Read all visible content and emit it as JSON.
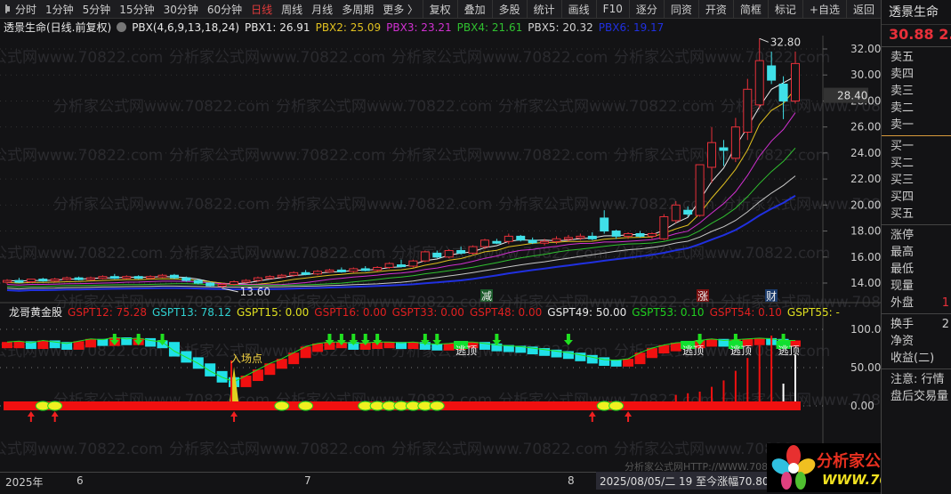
{
  "toolbar": {
    "periods": [
      "分时",
      "1分钟",
      "5分钟",
      "15分钟",
      "30分钟",
      "60分钟",
      "日线",
      "周线",
      "月线",
      "多周期",
      "更多 〉"
    ],
    "active_period": "日线",
    "buttons": [
      "复权",
      "叠加",
      "多股",
      "统计",
      "画线",
      "F10",
      "逐分",
      "同资",
      "开资",
      "简框",
      "标记",
      "+自选",
      "返回"
    ]
  },
  "main_header": {
    "title": "透景生命(日线.前复权)",
    "indicator": "PBX(4,6,9,13,18,24)",
    "values": [
      {
        "label": "PBX1: 26.91",
        "color": "#e8e8e8"
      },
      {
        "label": "PBX2: 25.09",
        "color": "#e0c020"
      },
      {
        "label": "PBX3: 23.21",
        "color": "#d030d0"
      },
      {
        "label": "PBX4: 21.61",
        "color": "#30c030"
      },
      {
        "label": "PBX5: 20.32",
        "color": "#d0d0d0"
      },
      {
        "label": "PBX6: 19.17",
        "color": "#2030e0"
      }
    ]
  },
  "price_axis": {
    "ticks": [
      "32.00",
      "30.00",
      "28.00",
      "26.00",
      "24.00",
      "22.00",
      "20.00",
      "18.00",
      "16.00",
      "14.00"
    ],
    "current": "28.40"
  },
  "annotations": {
    "high": "32.80",
    "low": "13.60",
    "markers": [
      {
        "text": "减",
        "bg": "#1a5a2a"
      },
      {
        "text": "涨",
        "bg": "#7a1010"
      },
      {
        "text": "财",
        "bg": "#1a3a6a"
      }
    ]
  },
  "indicator_header": {
    "title": "龙哥黄金股",
    "values": [
      {
        "label": "GSPT12: 75.28",
        "color": "#e02020"
      },
      {
        "label": "GSPT13: 78.12",
        "color": "#30d0d0"
      },
      {
        "label": "GSPT15: 0.00",
        "color": "#e0e020"
      },
      {
        "label": "GSPT16: 0.00",
        "color": "#e02020"
      },
      {
        "label": "GSPT33: 0.00",
        "color": "#e02020"
      },
      {
        "label": "GSPT48: 0.00",
        "color": "#e02020"
      },
      {
        "label": "GSPT49: 50.00",
        "color": "#e8e8e8"
      },
      {
        "label": "GSPT53: 0.10",
        "color": "#20d020"
      },
      {
        "label": "GSPT54: 0.10",
        "color": "#e02020"
      },
      {
        "label": "GSPT55: -",
        "color": "#e0e020"
      }
    ]
  },
  "indicator_axis": {
    "ticks": [
      "100.00",
      "50.00",
      "0.00"
    ]
  },
  "indicator_labels": {
    "entry": "入场点",
    "escape": "逃顶"
  },
  "date_axis": {
    "labels": [
      "2025年",
      "6",
      "7",
      "8"
    ],
    "cursor": "2025/08/05/二 19 至今涨幅70.80%"
  },
  "watermark": "分析家公式网www.70822.com",
  "watermark_bottom": "分析家公式网HTTP://WWW.70822.COM",
  "logo": {
    "cn": "分析家公式网",
    "url": "WWW.70822.COM"
  },
  "quote_panel": {
    "name": "透景生命",
    "price": "30.88",
    "change": "2.",
    "sell": [
      "卖五",
      "卖四",
      "卖三",
      "卖二",
      "卖一"
    ],
    "buy": [
      "买一",
      "买二",
      "买三",
      "买四",
      "买五"
    ],
    "stats": [
      {
        "label": "涨停",
        "value": ""
      },
      {
        "label": "最高",
        "value": ""
      },
      {
        "label": "最低",
        "value": ""
      },
      {
        "label": "现量",
        "value": ""
      },
      {
        "label": "外盘",
        "value": "1"
      }
    ],
    "stats2": [
      {
        "label": "换手",
        "value": "2"
      },
      {
        "label": "净资",
        "value": ""
      },
      {
        "label": "收益(二)",
        "value": ""
      }
    ],
    "notes": [
      "注意: 行情",
      "盘后交易量"
    ]
  },
  "colors": {
    "up": "#e8303a",
    "down": "#40e0e8",
    "bg": "#131315"
  },
  "chart_data": {
    "type": "candlestick",
    "ohlc": [
      [
        14.1,
        14.3,
        13.9,
        14.2
      ],
      [
        14.2,
        14.4,
        14.0,
        14.1
      ],
      [
        14.1,
        14.3,
        14.0,
        14.3
      ],
      [
        14.3,
        14.4,
        14.1,
        14.2
      ],
      [
        14.2,
        14.4,
        14.1,
        14.3
      ],
      [
        14.3,
        14.5,
        14.2,
        14.4
      ],
      [
        14.4,
        14.5,
        14.2,
        14.3
      ],
      [
        14.3,
        14.5,
        14.2,
        14.4
      ],
      [
        14.4,
        14.6,
        14.3,
        14.5
      ],
      [
        14.5,
        14.7,
        14.3,
        14.4
      ],
      [
        14.4,
        14.6,
        14.3,
        14.5
      ],
      [
        14.5,
        14.6,
        14.3,
        14.4
      ],
      [
        14.4,
        14.6,
        14.3,
        14.5
      ],
      [
        14.5,
        14.7,
        14.4,
        14.6
      ],
      [
        14.6,
        14.7,
        14.3,
        14.4
      ],
      [
        14.4,
        14.5,
        14.1,
        14.2
      ],
      [
        14.2,
        14.3,
        13.9,
        14.0
      ],
      [
        14.0,
        14.1,
        13.7,
        13.8
      ],
      [
        13.9,
        14.0,
        13.6,
        13.9
      ],
      [
        13.9,
        14.2,
        13.8,
        14.1
      ],
      [
        14.1,
        14.3,
        14.0,
        14.2
      ],
      [
        14.2,
        14.5,
        14.1,
        14.4
      ],
      [
        14.4,
        14.6,
        14.3,
        14.5
      ],
      [
        14.5,
        14.7,
        14.4,
        14.6
      ],
      [
        14.6,
        14.9,
        14.5,
        14.8
      ],
      [
        14.8,
        15.0,
        14.6,
        14.7
      ],
      [
        14.7,
        15.0,
        14.6,
        14.9
      ],
      [
        14.9,
        15.1,
        14.8,
        15.0
      ],
      [
        15.0,
        15.2,
        14.8,
        14.9
      ],
      [
        14.9,
        15.2,
        14.8,
        15.1
      ],
      [
        15.1,
        15.3,
        14.9,
        15.0
      ],
      [
        15.0,
        15.3,
        14.9,
        15.2
      ],
      [
        15.2,
        15.6,
        15.1,
        15.5
      ],
      [
        15.4,
        15.8,
        15.2,
        15.3
      ],
      [
        15.3,
        15.8,
        15.2,
        15.7
      ],
      [
        15.7,
        16.5,
        15.6,
        16.4
      ],
      [
        16.3,
        16.5,
        15.9,
        16.0
      ],
      [
        16.0,
        16.6,
        15.9,
        16.5
      ],
      [
        16.5,
        16.8,
        16.2,
        16.3
      ],
      [
        16.3,
        16.9,
        16.2,
        16.8
      ],
      [
        16.8,
        17.4,
        16.6,
        17.3
      ],
      [
        17.2,
        17.4,
        17.0,
        17.1
      ],
      [
        17.2,
        17.8,
        17.0,
        17.6
      ],
      [
        17.6,
        17.7,
        17.2,
        17.3
      ],
      [
        17.3,
        17.5,
        17.0,
        17.1
      ],
      [
        17.1,
        17.4,
        16.9,
        17.2
      ],
      [
        17.2,
        17.6,
        17.0,
        17.4
      ],
      [
        17.4,
        17.7,
        17.2,
        17.5
      ],
      [
        17.5,
        17.8,
        17.3,
        17.6
      ],
      [
        17.6,
        17.9,
        17.3,
        17.4
      ],
      [
        19.0,
        19.6,
        17.8,
        18.0
      ],
      [
        18.0,
        18.1,
        17.4,
        17.6
      ],
      [
        17.6,
        17.9,
        17.4,
        17.8
      ],
      [
        17.8,
        18.0,
        17.5,
        17.6
      ],
      [
        17.6,
        17.9,
        17.4,
        17.8
      ],
      [
        17.4,
        19.3,
        17.3,
        19.1
      ],
      [
        18.8,
        20.3,
        18.6,
        20.0
      ],
      [
        19.6,
        19.9,
        19.1,
        19.3
      ],
      [
        19.2,
        23.1,
        19.1,
        23.1
      ],
      [
        22.9,
        26.0,
        21.7,
        24.8
      ],
      [
        24.4,
        25.0,
        23.0,
        24.2
      ],
      [
        23.6,
        26.7,
        23.3,
        26.0
      ],
      [
        25.6,
        29.7,
        25.0,
        28.9
      ],
      [
        27.7,
        32.8,
        27.4,
        31.1
      ],
      [
        30.7,
        31.8,
        29.3,
        29.6
      ],
      [
        29.3,
        29.9,
        26.6,
        28.0
      ],
      [
        28.0,
        31.8,
        27.8,
        30.88
      ]
    ],
    "ma_periods": [
      4,
      6,
      9,
      13,
      18,
      24
    ],
    "ma_colors": [
      "#e8e8e8",
      "#e0c020",
      "#d030d0",
      "#30c030",
      "#c8c8c8",
      "#2030e0"
    ],
    "ylim": [
      13,
      33.5
    ],
    "indicator": {
      "ylim": [
        -12,
        115
      ],
      "line": [
        80,
        81,
        79,
        82,
        80,
        78,
        81,
        84,
        83,
        86,
        84,
        85,
        82,
        80,
        68,
        60,
        52,
        42,
        34,
        28,
        36,
        44,
        52,
        58,
        66,
        74,
        78,
        80,
        80,
        78,
        79,
        80,
        80,
        79,
        80,
        78,
        77,
        78,
        80,
        80,
        78,
        76,
        75,
        74,
        72,
        70,
        68,
        66,
        63,
        60,
        57,
        56,
        58,
        66,
        72,
        76,
        79,
        80,
        82,
        84,
        82,
        83,
        84,
        85,
        84,
        82,
        82
      ],
      "yellow_band_idx": [
        3,
        4,
        23,
        25,
        30,
        31,
        32,
        33,
        34,
        35,
        36,
        50,
        51
      ],
      "up_arrows_idx": [
        2,
        4,
        19,
        49,
        52
      ],
      "down_arrows_idx": [
        9,
        11,
        13,
        27,
        28,
        29,
        30,
        31,
        35,
        36,
        41,
        47,
        58,
        61,
        65
      ],
      "escape_idx": [
        38,
        57,
        61,
        65
      ],
      "volume_spikes": [
        3,
        4,
        5,
        8,
        12,
        18,
        26,
        34,
        40,
        10,
        28
      ]
    }
  }
}
